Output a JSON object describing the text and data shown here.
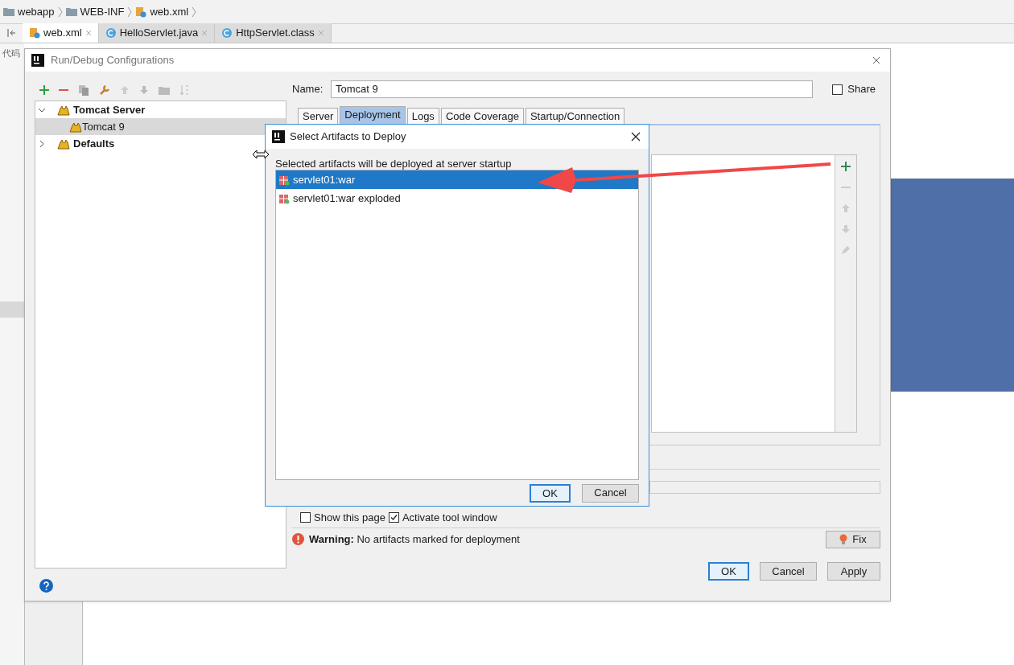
{
  "breadcrumb": [
    {
      "label": "webapp",
      "kind": "folder"
    },
    {
      "label": "WEB-INF",
      "kind": "folder"
    },
    {
      "label": "web.xml",
      "kind": "xml"
    }
  ],
  "editor_tabs": [
    {
      "label": "web.xml",
      "kind": "xml",
      "selected": true
    },
    {
      "label": "HelloServlet.java",
      "kind": "class",
      "selected": false
    },
    {
      "label": "HttpServlet.class",
      "kind": "class",
      "selected": false
    }
  ],
  "gutter_text": "代码",
  "config_dialog": {
    "title": "Run/Debug Configurations",
    "tree": [
      {
        "label": "Tomcat Server",
        "expanded": true,
        "selected": false,
        "children": [
          {
            "label": "Tomcat 9",
            "selected": true
          }
        ]
      },
      {
        "label": "Defaults",
        "expanded": false,
        "selected": false
      }
    ],
    "name_label": "Name:",
    "name_value": "Tomcat 9",
    "share": {
      "label": "Share",
      "checked": false
    },
    "tabs": [
      {
        "label": "Server",
        "selected": false
      },
      {
        "label": "Deployment",
        "selected": true
      },
      {
        "label": "Logs",
        "selected": false
      },
      {
        "label": "Code Coverage",
        "selected": false
      },
      {
        "label": "Startup/Connection",
        "selected": false
      }
    ],
    "options": [
      {
        "label": "Show this page",
        "checked": false
      },
      {
        "label": "Activate tool window",
        "checked": true
      }
    ],
    "warning": {
      "label": "Warning:",
      "message": "No artifacts marked for deployment"
    },
    "fix_button": "Fix",
    "buttons": [
      {
        "label": "OK",
        "default": true
      },
      {
        "label": "Cancel",
        "default": false
      },
      {
        "label": "Apply",
        "default": false
      }
    ]
  },
  "artifacts_dialog": {
    "title": "Select Artifacts to Deploy",
    "hint": "Selected artifacts will be deployed at server startup",
    "items": [
      {
        "label": "servlet01:war",
        "selected": true
      },
      {
        "label": "servlet01:war exploded",
        "selected": false
      }
    ],
    "buttons": [
      {
        "label": "OK",
        "default": true
      },
      {
        "label": "Cancel",
        "default": false
      }
    ]
  }
}
